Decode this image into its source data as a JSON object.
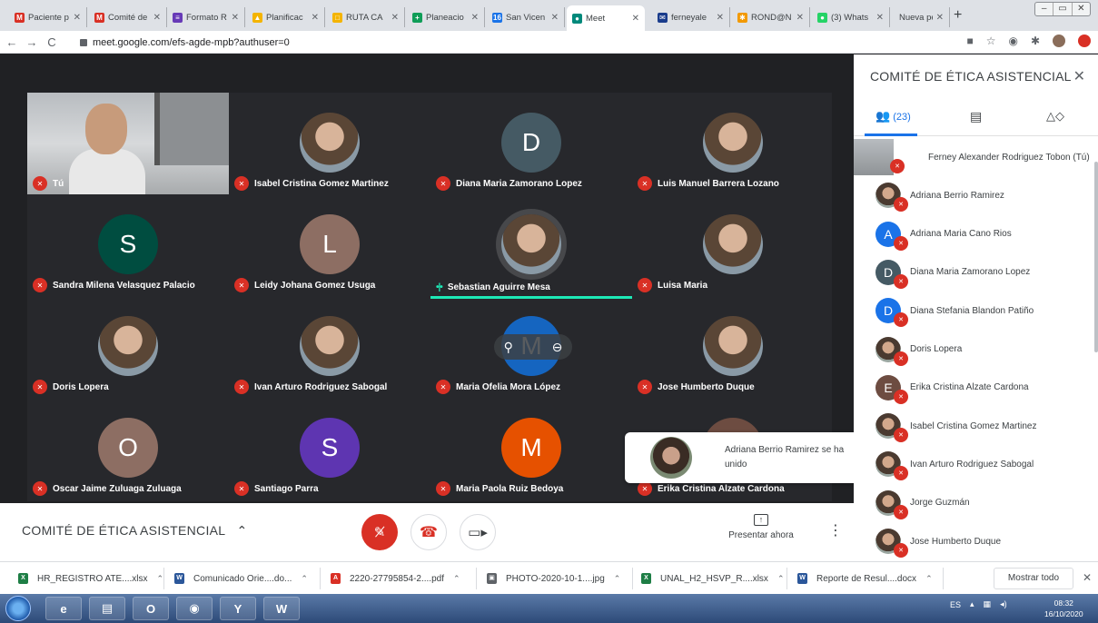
{
  "browser": {
    "tabs": [
      {
        "title": "Paciente p",
        "favicon": "gmail-icon",
        "color": "#d93025",
        "glyph": "M"
      },
      {
        "title": "Comité de",
        "favicon": "gmail-icon",
        "color": "#d93025",
        "glyph": "M"
      },
      {
        "title": "Formato R",
        "favicon": "forms-icon",
        "color": "#673ab7",
        "glyph": "≡"
      },
      {
        "title": "Planificac",
        "favicon": "drive-icon",
        "color": "#f4b400",
        "glyph": "▲"
      },
      {
        "title": "RUTA CA",
        "favicon": "slides-icon",
        "color": "#f4b400",
        "glyph": "□"
      },
      {
        "title": "Planeacio",
        "favicon": "sheets-icon",
        "color": "#0f9d58",
        "glyph": "+"
      },
      {
        "title": "San Vicen",
        "favicon": "calendar-icon",
        "color": "#1a73e8",
        "glyph": "16"
      },
      {
        "title": "Meet",
        "favicon": "meet-icon",
        "color": "#00897b",
        "glyph": "●",
        "active": true
      },
      {
        "title": "ferneyale",
        "favicon": "mail-icon",
        "color": "#1a3c8c",
        "glyph": "✉"
      },
      {
        "title": "ROND@N",
        "favicon": "rondon-icon",
        "color": "#f29900",
        "glyph": "✱"
      },
      {
        "title": "(3) Whats",
        "favicon": "whatsapp-icon",
        "color": "#25d366",
        "glyph": "●"
      },
      {
        "title": "Nueva pestaña",
        "favicon": "",
        "color": "",
        "glyph": ""
      }
    ],
    "new_tab": "+",
    "url": "meet.google.com/efs-agde-mpb?authuser=0"
  },
  "meeting": {
    "title": "COMITÉ DE ÉTICA ASISTENCIAL",
    "tiles": [
      {
        "name": "Tú",
        "type": "self",
        "muted": true
      },
      {
        "name": "Isabel Cristina Gomez Martinez",
        "type": "photo",
        "muted": true
      },
      {
        "name": "Diana Maria Zamorano Lopez",
        "type": "letter",
        "letter": "D",
        "color": "#455a64",
        "muted": true
      },
      {
        "name": "Luis Manuel Barrera Lozano",
        "type": "photo",
        "muted": true
      },
      {
        "name": "Sandra Milena Velasquez Palacio",
        "type": "letter",
        "letter": "S",
        "color": "#004d40",
        "muted": true
      },
      {
        "name": "Leidy Johana Gomez Usuga",
        "type": "letter",
        "letter": "L",
        "color": "#8d6e63",
        "muted": true
      },
      {
        "name": "Sebastian Aguirre Mesa",
        "type": "photo",
        "speaking": true
      },
      {
        "name": "Luisa Maria",
        "type": "photo",
        "muted": true
      },
      {
        "name": "Doris Lopera",
        "type": "photo",
        "muted": true
      },
      {
        "name": "Ivan Arturo Rodriguez Sabogal",
        "type": "photo",
        "muted": true
      },
      {
        "name": "Maria Ofelia Mora López",
        "type": "letter",
        "letter": "M",
        "color": "#1565c0",
        "muted": true,
        "hover": true
      },
      {
        "name": "Jose Humberto Duque",
        "type": "photo",
        "muted": true
      },
      {
        "name": "Oscar Jaime Zuluaga Zuluaga",
        "type": "letter",
        "letter": "O",
        "color": "#8d6e63",
        "muted": true
      },
      {
        "name": "Santiago Parra",
        "type": "letter",
        "letter": "S",
        "color": "#5e35b1",
        "muted": true
      },
      {
        "name": "Maria Paola Ruiz Bedoya",
        "type": "letter",
        "letter": "M",
        "color": "#e65100",
        "muted": true
      },
      {
        "name": "Erika Cristina Alzate Cardona",
        "type": "letter",
        "letter": "E",
        "color": "#6d4c41",
        "muted": true
      }
    ],
    "toast": "Adriana Berrio Ramirez se ha unido",
    "present_label": "Presentar ahora"
  },
  "panel": {
    "title": "COMITÉ DE ÉTICA ASISTENCIAL",
    "people_count": "(23)",
    "participants": [
      {
        "name": "Ferney Alexander Rodriguez Tobon (Tú)",
        "type": "self"
      },
      {
        "name": "Adriana Berrio Ramirez",
        "type": "photo"
      },
      {
        "name": "Adriana Maria Cano Rios",
        "type": "letter",
        "letter": "A",
        "color": "#1a73e8"
      },
      {
        "name": "Diana Maria Zamorano Lopez",
        "type": "letter",
        "letter": "D",
        "color": "#455a64"
      },
      {
        "name": "Diana Stefania Blandon Patiño",
        "type": "letter",
        "letter": "D",
        "color": "#1a73e8"
      },
      {
        "name": "Doris Lopera",
        "type": "photo"
      },
      {
        "name": "Erika Cristina Alzate Cardona",
        "type": "letter",
        "letter": "E",
        "color": "#6d4c41"
      },
      {
        "name": "Isabel Cristina Gomez Martinez",
        "type": "photo"
      },
      {
        "name": "Ivan Arturo Rodriguez Sabogal",
        "type": "photo"
      },
      {
        "name": "Jorge Guzmán",
        "type": "photo"
      },
      {
        "name": "Jose Humberto Duque",
        "type": "photo"
      }
    ]
  },
  "downloads": {
    "items": [
      {
        "name": "HR_REGISTRO ATE....xlsx",
        "icon": "excel-icon",
        "color": "#1e7e45",
        "glyph": "X"
      },
      {
        "name": "Comunicado Orie....do...",
        "icon": "word-icon",
        "color": "#2b579a",
        "glyph": "W"
      },
      {
        "name": "2220-27795854-2....pdf",
        "icon": "pdf-icon",
        "color": "#d93025",
        "glyph": "A"
      },
      {
        "name": "PHOTO-2020-10-1....jpg",
        "icon": "image-icon",
        "color": "#5f6368",
        "glyph": "▣"
      },
      {
        "name": "UNAL_H2_HSVP_R....xlsx",
        "icon": "excel-icon",
        "color": "#1e7e45",
        "glyph": "X"
      },
      {
        "name": "Reporte de Resul....docx",
        "icon": "word-icon",
        "color": "#2b579a",
        "glyph": "W"
      }
    ],
    "show_all": "Mostrar todo"
  },
  "taskbar": {
    "lang": "ES",
    "time": "08:32",
    "date": "16/10/2020"
  }
}
